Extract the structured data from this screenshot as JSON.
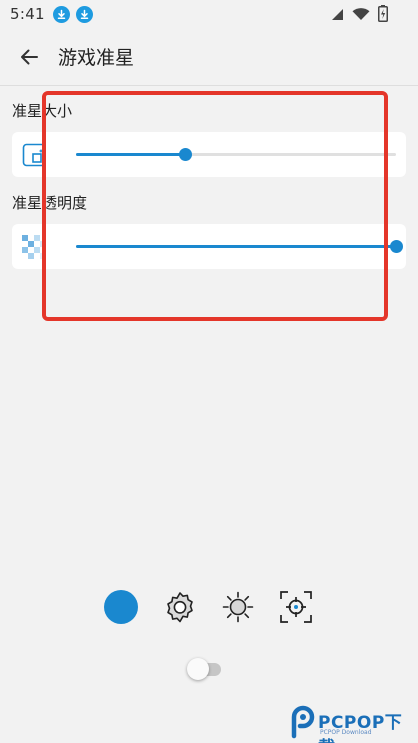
{
  "status_bar": {
    "time": "5:41"
  },
  "app_bar": {
    "title": "游戏准星"
  },
  "sections": [
    {
      "label": "准星大小",
      "slider_value": 0.34
    },
    {
      "label": "准星透明度",
      "slider_value": 1.0
    }
  ],
  "bottom_icons": [
    "color-dot",
    "gear-icon",
    "brightness-icon",
    "crosshair-icon"
  ],
  "colors": {
    "accent": "#1a88cf",
    "highlight": "#e4362a",
    "background": "#f2f2f2"
  },
  "toggle": {
    "on": false
  },
  "watermark": {
    "brand": "PCPOP下载",
    "sub": "PCPOP Download"
  }
}
